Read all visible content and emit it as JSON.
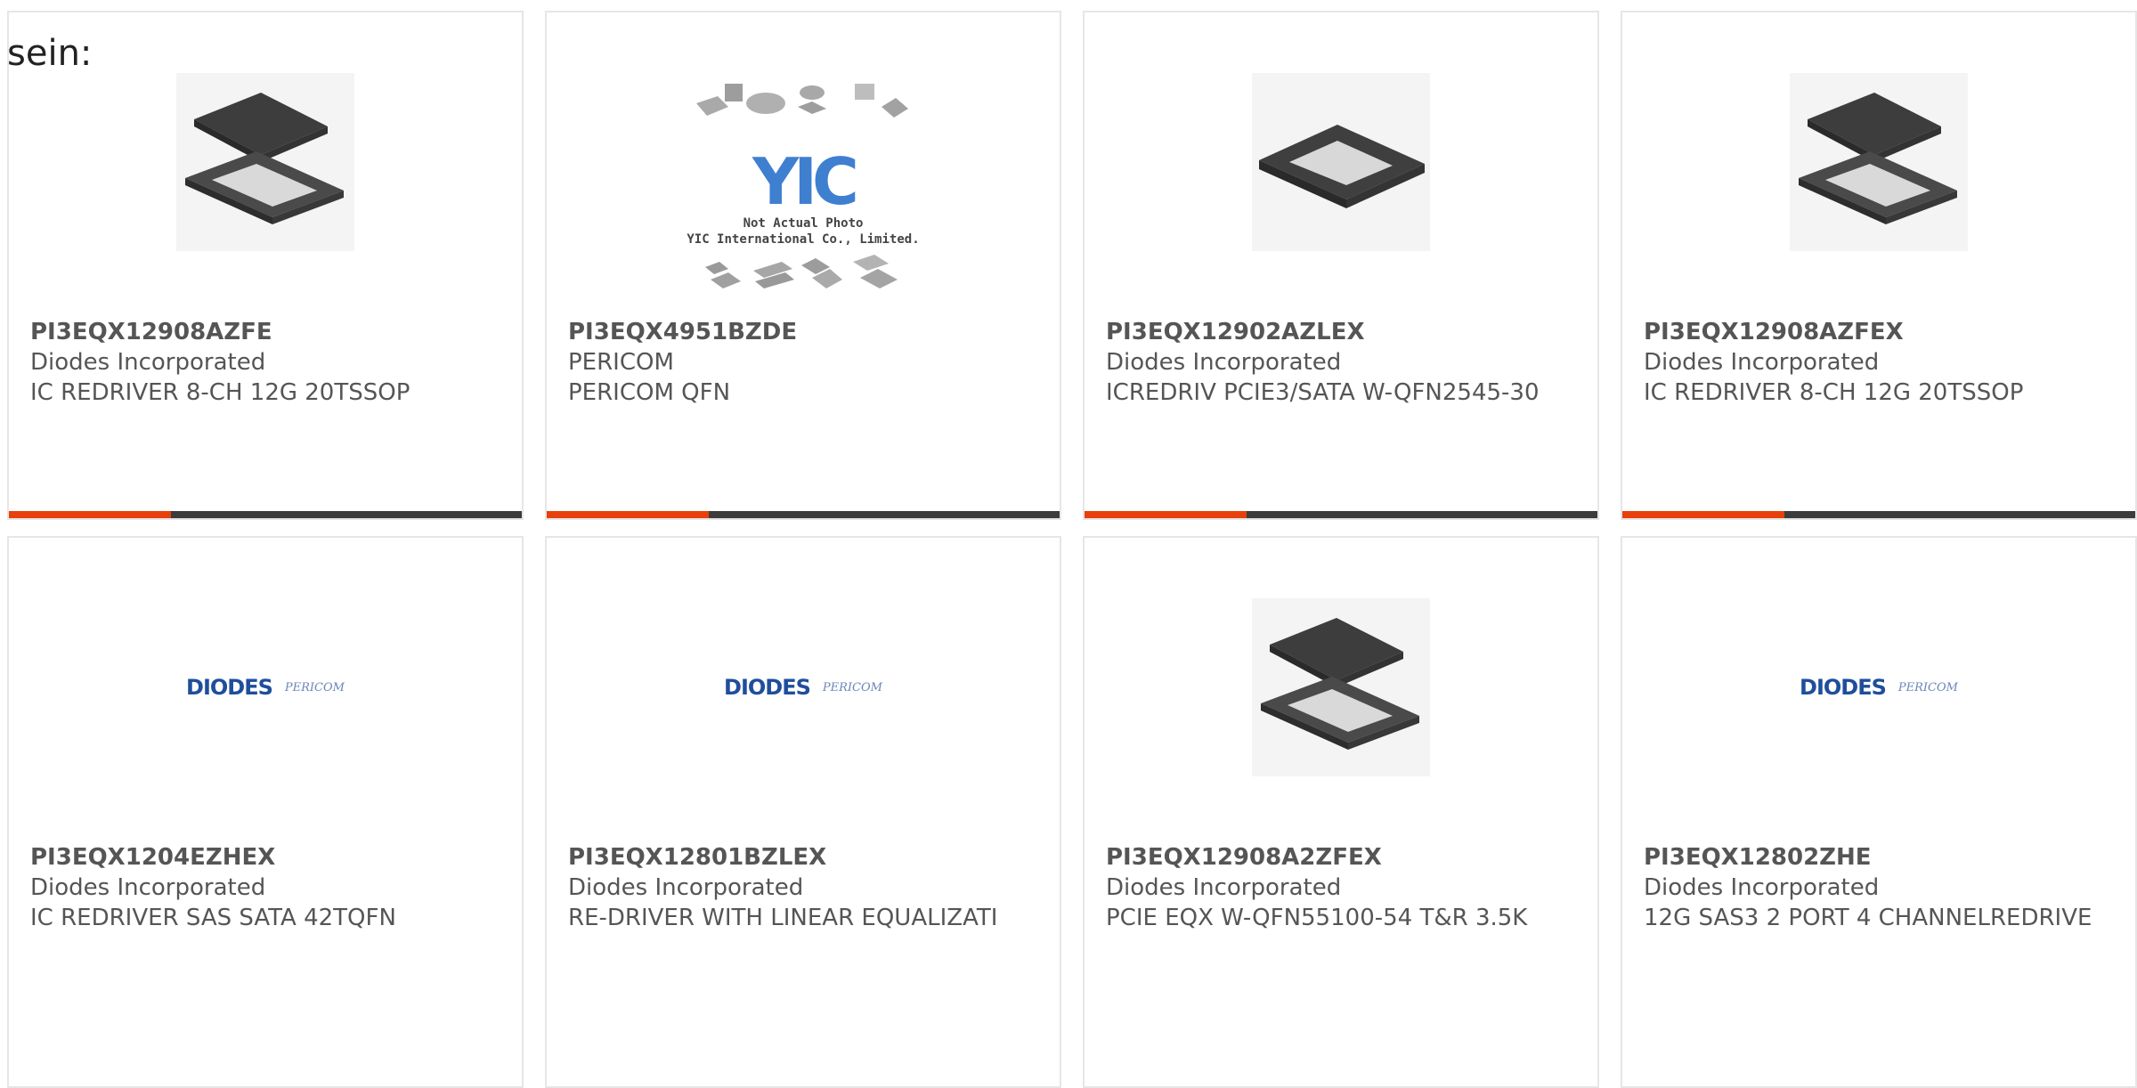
{
  "intro": "sein:",
  "colors": {
    "accent": "#e8400c",
    "bar": "#3c3c3c",
    "border": "#e6e6e6",
    "text": "#555555"
  },
  "products": [
    {
      "part": "PI3EQX12908AZFE",
      "maker": "Diodes Incorporated",
      "desc": "IC REDRIVER 8-CH 12G 20TSSOP",
      "image": "chip-lid-and-package"
    },
    {
      "part": "PI3EQX4951BZDE",
      "maker": "PERICOM",
      "desc": "PERICOM QFN",
      "image": "yic-placeholder",
      "image_logo": "YIC",
      "image_note": "Not Actual Photo\nYIC International Co., Limited."
    },
    {
      "part": "PI3EQX12902AZLEX",
      "maker": "Diodes Incorporated",
      "desc": "ICREDRIV PCIE3/SATA W-QFN2545-30",
      "image": "chip-qfn-package"
    },
    {
      "part": "PI3EQX12908AZFEX",
      "maker": "Diodes Incorporated",
      "desc": "IC REDRIVER 8-CH 12G 20TSSOP",
      "image": "chip-lid-and-package"
    },
    {
      "part": "PI3EQX1204EZHEX",
      "maker": "Diodes Incorporated",
      "desc": "IC REDRIVER SAS SATA 42TQFN",
      "image": "diodes-pericom-logo",
      "image_logo_left": "DIODES",
      "image_logo_right": "PERICOM"
    },
    {
      "part": "PI3EQX12801BZLEX",
      "maker": "Diodes Incorporated",
      "desc": "RE-DRIVER WITH LINEAR EQUALIZATI",
      "image": "diodes-pericom-logo",
      "image_logo_left": "DIODES",
      "image_logo_right": "PERICOM"
    },
    {
      "part": "PI3EQX12908A2ZFEX",
      "maker": "Diodes Incorporated",
      "desc": "PCIE EQX W-QFN55100-54 T&R 3.5K",
      "image": "chip-lid-and-package"
    },
    {
      "part": "PI3EQX12802ZHE",
      "maker": "Diodes Incorporated",
      "desc": "12G SAS3 2 PORT 4 CHANNELREDRIVE",
      "image": "diodes-pericom-logo",
      "image_logo_left": "DIODES",
      "image_logo_right": "PERICOM"
    }
  ]
}
